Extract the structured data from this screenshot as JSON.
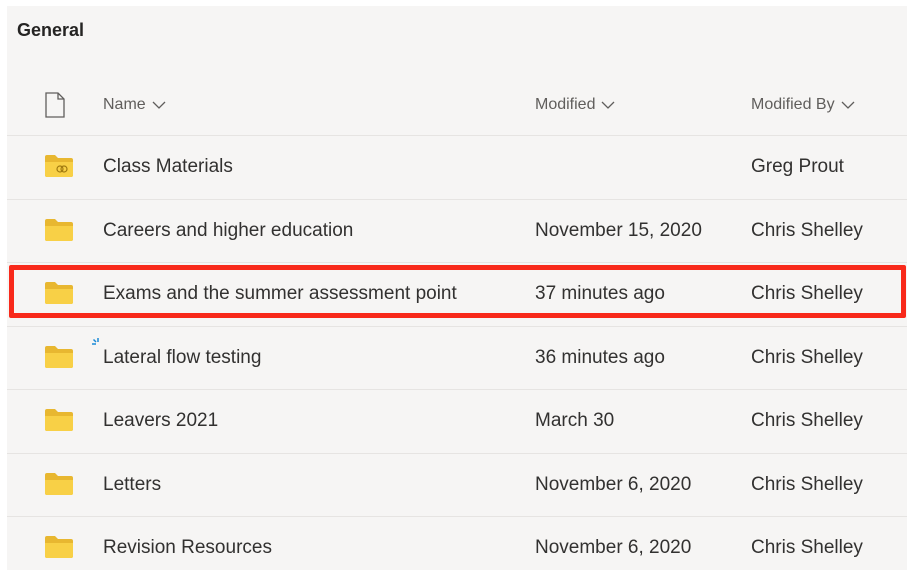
{
  "library": {
    "title": "General"
  },
  "columns": {
    "name": "Name",
    "modified": "Modified",
    "modified_by": "Modified By"
  },
  "icons": {
    "file_type": "document-icon",
    "sort": "chevron-down-icon",
    "folder": "folder-icon",
    "shared_folder": "shared-folder-icon",
    "syncing": "sync-spinner-icon"
  },
  "colors": {
    "folder": "#f8d046",
    "highlight": "#f8291a",
    "spinner": "#1a8ad6"
  },
  "rows": [
    {
      "name": "Class Materials",
      "modified": "",
      "modified_by": "Greg Prout",
      "icon": "shared-folder-icon"
    },
    {
      "name": "Careers and higher education",
      "modified": "November 15, 2020",
      "modified_by": "Chris Shelley",
      "icon": "folder-icon"
    },
    {
      "name": "Exams and the summer assessment point",
      "modified": "37 minutes ago",
      "modified_by": "Chris Shelley",
      "icon": "folder-icon",
      "highlighted": true
    },
    {
      "name": "Lateral flow testing",
      "modified": "36 minutes ago",
      "modified_by": "Chris Shelley",
      "icon": "folder-icon",
      "syncing": true
    },
    {
      "name": "Leavers 2021",
      "modified": "March 30",
      "modified_by": "Chris Shelley",
      "icon": "folder-icon"
    },
    {
      "name": "Letters",
      "modified": "November 6, 2020",
      "modified_by": "Chris Shelley",
      "icon": "folder-icon"
    },
    {
      "name": "Revision Resources",
      "modified": "November 6, 2020",
      "modified_by": "Chris Shelley",
      "icon": "folder-icon"
    }
  ]
}
